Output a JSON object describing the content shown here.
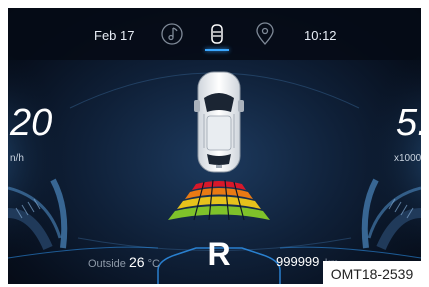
{
  "status_bar": {
    "date": "Feb 17",
    "time": "10:12",
    "icons": [
      "music-icon",
      "vehicle-status-icon",
      "location-pin-icon"
    ],
    "active_icon": "vehicle-status-icon",
    "accent_color": "#3aa7ff"
  },
  "left_gauge": {
    "speed_value": "20",
    "unit": "n/h"
  },
  "right_gauge": {
    "rpm_value": "5.",
    "unit": "x1000"
  },
  "parking_sensor": {
    "zone_colors": [
      "#d8182a",
      "#e87a14",
      "#e6c21c",
      "#7fc22a"
    ]
  },
  "gear": {
    "value": "R"
  },
  "outside_temp": {
    "label": "Outside",
    "value": "26",
    "unit": "°C"
  },
  "odometer": {
    "value": "999999",
    "unit": "km"
  },
  "reference_code": "OMT18-2539"
}
